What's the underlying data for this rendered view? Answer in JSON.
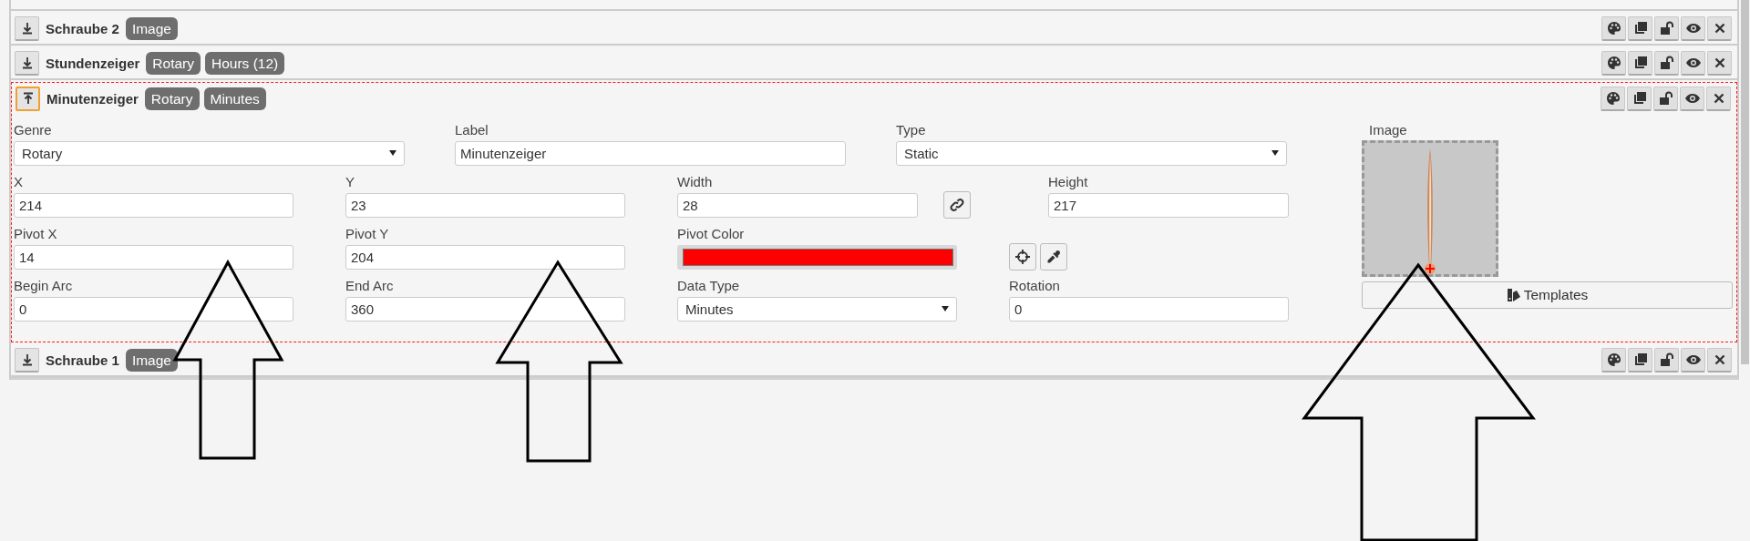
{
  "layers": [
    {
      "name": "Schraube 2",
      "tags": [
        "Image"
      ],
      "expanded": false
    },
    {
      "name": "Stundenzeiger",
      "tags": [
        "Rotary",
        "Hours (12)"
      ],
      "expanded": false
    },
    {
      "name": "Minutenzeiger",
      "tags": [
        "Rotary",
        "Minutes"
      ],
      "expanded": true,
      "form_rows": [
        [
          {
            "label": "Genre",
            "kind": "select",
            "value": "Rotary"
          },
          {
            "label": "Label",
            "kind": "input",
            "value": "Minutenzeiger"
          },
          {
            "label": "Type",
            "kind": "select",
            "value": "Static"
          }
        ],
        [
          {
            "label": "X",
            "kind": "input",
            "value": "214"
          },
          {
            "label": "Y",
            "kind": "input",
            "value": "23"
          },
          {
            "label": "Width",
            "kind": "linked-input",
            "value": "28"
          },
          {
            "label": "Height",
            "kind": "input",
            "value": "217"
          }
        ],
        [
          {
            "label": "Pivot X",
            "kind": "input",
            "value": "14"
          },
          {
            "label": "Pivot Y",
            "kind": "input",
            "value": "204"
          },
          {
            "label": "Pivot Color",
            "kind": "color",
            "color": "#ff0000"
          },
          {
            "kind": "pick-buttons"
          }
        ],
        [
          {
            "label": "Begin Arc",
            "kind": "input",
            "value": "0"
          },
          {
            "label": "End Arc",
            "kind": "input",
            "value": "360"
          },
          {
            "label": "Data Type",
            "kind": "select",
            "value": "Minutes"
          },
          {
            "label": "Rotation",
            "kind": "input",
            "value": "0"
          }
        ]
      ],
      "image": {
        "label": "Image"
      },
      "templates_button": "Templates"
    },
    {
      "name": "Schraube 1",
      "tags": [
        "Image"
      ],
      "expanded": false
    }
  ]
}
